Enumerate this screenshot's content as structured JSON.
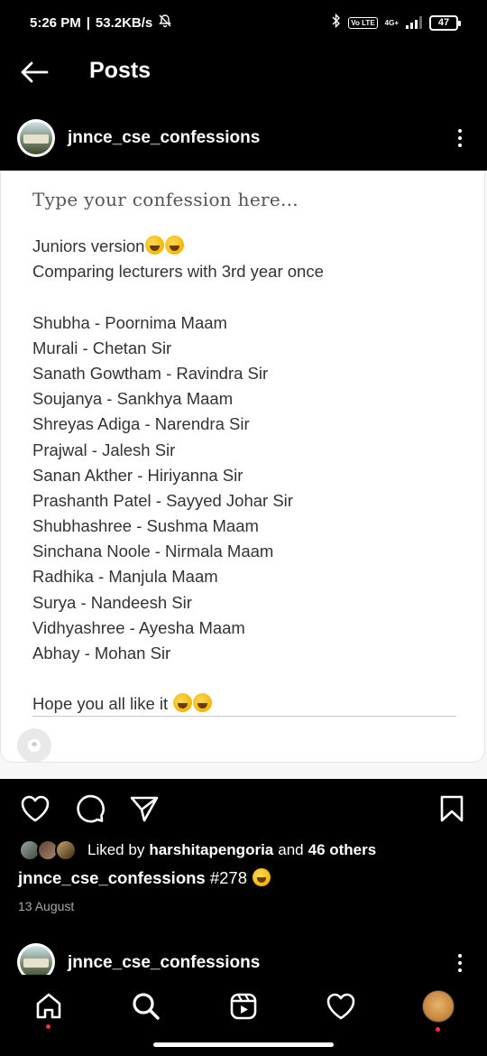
{
  "status_bar": {
    "time": "5:26 PM",
    "separator": "|",
    "speed": "53.2KB/s",
    "volte": "Vo LTE",
    "network": "4G+",
    "battery": "47"
  },
  "header": {
    "title": "Posts",
    "back_icon": "arrow-left-icon"
  },
  "post": {
    "username": "jnnce_cse_confessions",
    "more_icon": "more-vertical-icon",
    "image": {
      "placeholder": "Type your confession here...",
      "lines": [
        "Juniors version",
        "Comparing lecturers with 3rd year once",
        "",
        "Shubha - Poornima Maam",
        "Murali - Chetan Sir",
        "Sanath Gowtham - Ravindra Sir",
        "Soujanya - Sankhya Maam",
        "Shreyas Adiga - Narendra Sir",
        "Prajwal - Jalesh Sir",
        "Sanan Akther - Hiriyanna Sir",
        "Prashanth Patel - Sayyed Johar Sir",
        "Shubhashree - Sushma Maam",
        "Sinchana Noole - Nirmala Maam",
        "Radhika - Manjula Maam",
        "Surya - Nandeesh Sir",
        "Vidhyashree - Ayesha Maam",
        "Abhay - Mohan Sir",
        "",
        "Hope you all like it "
      ]
    },
    "actions": {
      "like_icon": "heart-icon",
      "comment_icon": "comment-icon",
      "share_icon": "send-icon",
      "save_icon": "bookmark-icon"
    },
    "likes": {
      "prefix": "Liked by",
      "user": "harshitapengoria",
      "and": "and",
      "others": "46 others"
    },
    "caption": {
      "username": "jnnce_cse_confessions",
      "text": "#278"
    },
    "date": "13 August"
  },
  "next_post": {
    "username": "jnnce_cse_confessions"
  },
  "bottom_nav": {
    "items": [
      "home-icon",
      "search-icon",
      "reels-icon",
      "activity-heart-icon",
      "profile-avatar"
    ]
  },
  "colors": {
    "background": "#000000",
    "card": "#ffffff",
    "notification_dot": "#ff3040",
    "muted_text": "#a8a8a8"
  }
}
